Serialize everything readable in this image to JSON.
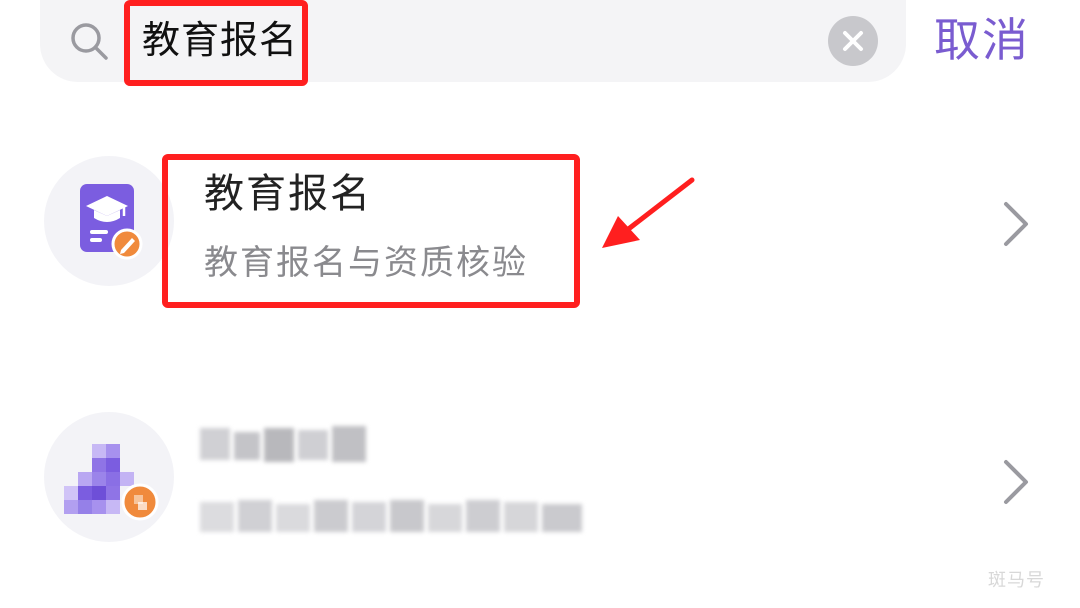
{
  "search": {
    "query": "教育报名",
    "cancel_label": "取消"
  },
  "results": [
    {
      "title": "教育报名",
      "subtitle": "教育报名与资质核验",
      "icon": "education-registration-icon"
    },
    {
      "title": "",
      "subtitle": "",
      "icon": "pixelated-person-icon",
      "obscured": true
    }
  ],
  "watermark": "斑马号",
  "colors": {
    "accent": "#7a5cd0",
    "annotation_red": "#ff1f1f",
    "badge_orange": "#f08a3c"
  }
}
